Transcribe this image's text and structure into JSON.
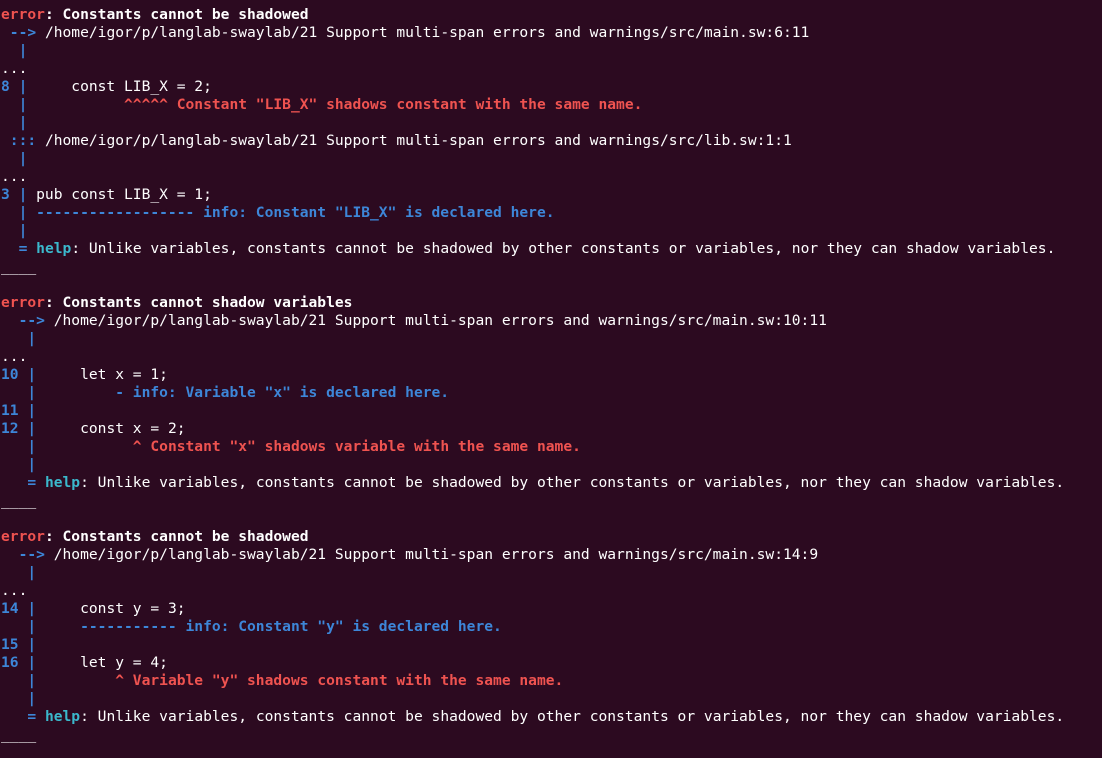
{
  "colors": {
    "background": "#2c0a20",
    "text": "#ffffff",
    "error": "#ef5350",
    "gutter": "#3d86d8",
    "help": "#3bb8cc"
  },
  "lines": [
    [
      {
        "t": "error",
        "c": "red"
      },
      {
        "t": ": Constants cannot be shadowed",
        "c": "bold"
      }
    ],
    [
      {
        "t": " -->",
        "c": "blue"
      },
      {
        "t": " /home/igor/p/langlab-swaylab/21 Support multi-span errors and warnings/src/main.sw:6:11",
        "c": "white"
      }
    ],
    [
      {
        "t": "  |",
        "c": "blue"
      }
    ],
    [
      {
        "t": "...",
        "c": "white"
      }
    ],
    [
      {
        "t": "8 |",
        "c": "blue"
      },
      {
        "t": "     const LIB_X = 2;",
        "c": "white"
      }
    ],
    [
      {
        "t": "  |",
        "c": "blue"
      },
      {
        "t": "           ^^^^^ Constant \"LIB_X\" shadows constant with the same name.",
        "c": "red"
      }
    ],
    [
      {
        "t": "  |",
        "c": "blue"
      }
    ],
    [
      {
        "t": " :::",
        "c": "blue"
      },
      {
        "t": " /home/igor/p/langlab-swaylab/21 Support multi-span errors and warnings/src/lib.sw:1:1",
        "c": "white"
      }
    ],
    [
      {
        "t": "  |",
        "c": "blue"
      }
    ],
    [
      {
        "t": "...",
        "c": "white"
      }
    ],
    [
      {
        "t": "3 |",
        "c": "blue"
      },
      {
        "t": " pub const LIB_X = 1;",
        "c": "white"
      }
    ],
    [
      {
        "t": "  | ------------------ info: Constant \"LIB_X\" is declared here.",
        "c": "blue"
      }
    ],
    [
      {
        "t": "  |",
        "c": "blue"
      }
    ],
    [
      {
        "t": "  = ",
        "c": "blue"
      },
      {
        "t": "help",
        "c": "cyan"
      },
      {
        "t": ": Unlike variables, constants cannot be shadowed by other constants or variables, nor they can shadow variables.",
        "c": "white"
      }
    ],
    [
      {
        "t": "____",
        "c": "white"
      }
    ],
    [
      {
        "t": "",
        "c": "white"
      }
    ],
    [
      {
        "t": "error",
        "c": "red"
      },
      {
        "t": ": Constants cannot shadow variables",
        "c": "bold"
      }
    ],
    [
      {
        "t": "  -->",
        "c": "blue"
      },
      {
        "t": " /home/igor/p/langlab-swaylab/21 Support multi-span errors and warnings/src/main.sw:10:11",
        "c": "white"
      }
    ],
    [
      {
        "t": "   |",
        "c": "blue"
      }
    ],
    [
      {
        "t": "...",
        "c": "white"
      }
    ],
    [
      {
        "t": "10 |",
        "c": "blue"
      },
      {
        "t": "     let x = 1;",
        "c": "white"
      }
    ],
    [
      {
        "t": "   |         - info: Variable \"x\" is declared here.",
        "c": "blue"
      }
    ],
    [
      {
        "t": "11 |",
        "c": "blue"
      }
    ],
    [
      {
        "t": "12 |",
        "c": "blue"
      },
      {
        "t": "     const x = 2;",
        "c": "white"
      }
    ],
    [
      {
        "t": "   |",
        "c": "blue"
      },
      {
        "t": "           ^ Constant \"x\" shadows variable with the same name.",
        "c": "red"
      }
    ],
    [
      {
        "t": "   |",
        "c": "blue"
      }
    ],
    [
      {
        "t": "   = ",
        "c": "blue"
      },
      {
        "t": "help",
        "c": "cyan"
      },
      {
        "t": ": Unlike variables, constants cannot be shadowed by other constants or variables, nor they can shadow variables.",
        "c": "white"
      }
    ],
    [
      {
        "t": "____",
        "c": "white"
      }
    ],
    [
      {
        "t": "",
        "c": "white"
      }
    ],
    [
      {
        "t": "error",
        "c": "red"
      },
      {
        "t": ": Constants cannot be shadowed",
        "c": "bold"
      }
    ],
    [
      {
        "t": "  -->",
        "c": "blue"
      },
      {
        "t": " /home/igor/p/langlab-swaylab/21 Support multi-span errors and warnings/src/main.sw:14:9",
        "c": "white"
      }
    ],
    [
      {
        "t": "   |",
        "c": "blue"
      }
    ],
    [
      {
        "t": "...",
        "c": "white"
      }
    ],
    [
      {
        "t": "14 |",
        "c": "blue"
      },
      {
        "t": "     const y = 3;",
        "c": "white"
      }
    ],
    [
      {
        "t": "   |     ----------- info: Constant \"y\" is declared here.",
        "c": "blue"
      }
    ],
    [
      {
        "t": "15 |",
        "c": "blue"
      }
    ],
    [
      {
        "t": "16 |",
        "c": "blue"
      },
      {
        "t": "     let y = 4;",
        "c": "white"
      }
    ],
    [
      {
        "t": "   |",
        "c": "blue"
      },
      {
        "t": "         ^ Variable \"y\" shadows constant with the same name.",
        "c": "red"
      }
    ],
    [
      {
        "t": "   |",
        "c": "blue"
      }
    ],
    [
      {
        "t": "   = ",
        "c": "blue"
      },
      {
        "t": "help",
        "c": "cyan"
      },
      {
        "t": ": Unlike variables, constants cannot be shadowed by other constants or variables, nor they can shadow variables.",
        "c": "white"
      }
    ],
    [
      {
        "t": "____",
        "c": "white"
      }
    ]
  ]
}
